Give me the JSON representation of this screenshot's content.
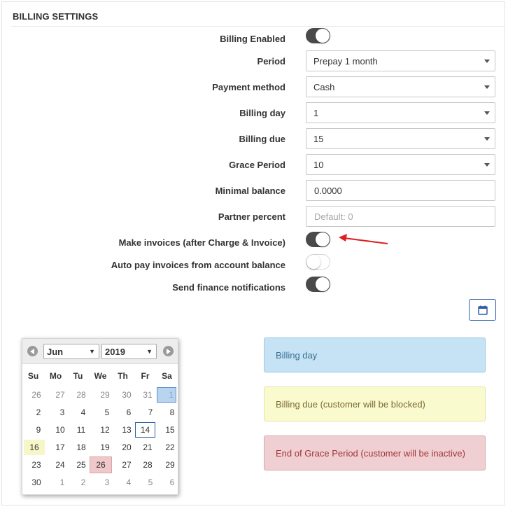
{
  "section": {
    "title": "BILLING SETTINGS"
  },
  "fields": {
    "billing_enabled": {
      "label": "Billing Enabled",
      "state": "on"
    },
    "period": {
      "label": "Period",
      "value": "Prepay 1 month"
    },
    "payment_method": {
      "label": "Payment method",
      "value": "Cash"
    },
    "billing_day": {
      "label": "Billing day",
      "value": "1"
    },
    "billing_due": {
      "label": "Billing due",
      "value": "15"
    },
    "grace_period": {
      "label": "Grace Period",
      "value": "10"
    },
    "minimal_balance": {
      "label": "Minimal balance",
      "value": "0.0000"
    },
    "partner_percent": {
      "label": "Partner percent",
      "placeholder": "Default: 0"
    },
    "make_invoices": {
      "label": "Make invoices (after Charge & Invoice)",
      "state": "on"
    },
    "auto_pay": {
      "label": "Auto pay invoices from account balance",
      "state": "off"
    },
    "finance_notifications": {
      "label": "Send finance notifications",
      "state": "on"
    }
  },
  "datepicker": {
    "month": "Jun",
    "year": "2019",
    "weekdays": [
      "Su",
      "Mo",
      "Tu",
      "We",
      "Th",
      "Fr",
      "Sa"
    ],
    "weeks": [
      [
        "26",
        "27",
        "28",
        "29",
        "30",
        "31",
        "1"
      ],
      [
        "2",
        "3",
        "4",
        "5",
        "6",
        "7",
        "8"
      ],
      [
        "9",
        "10",
        "11",
        "12",
        "13",
        "14",
        "15"
      ],
      [
        "16",
        "17",
        "18",
        "19",
        "20",
        "21",
        "22"
      ],
      [
        "23",
        "24",
        "25",
        "26",
        "27",
        "28",
        "29"
      ],
      [
        "30",
        "1",
        "2",
        "3",
        "4",
        "5",
        "6"
      ]
    ]
  },
  "legend": {
    "billing_day": "Billing day",
    "billing_due": "Billing due (customer will be blocked)",
    "grace_end": "End of Grace Period (customer will be inactive)"
  },
  "colors": {
    "accent": "#2c5ea8",
    "toggle_on": "#4a4a4a",
    "arrow": "#e02020",
    "billing_day_bg": "#c5e3f4",
    "billing_due_bg": "#fafacf",
    "grace_bg": "#efcfd2"
  },
  "icons": {
    "calendar_button": "calendar-icon",
    "prev": "chevron-left-icon",
    "next": "chevron-right-icon"
  }
}
